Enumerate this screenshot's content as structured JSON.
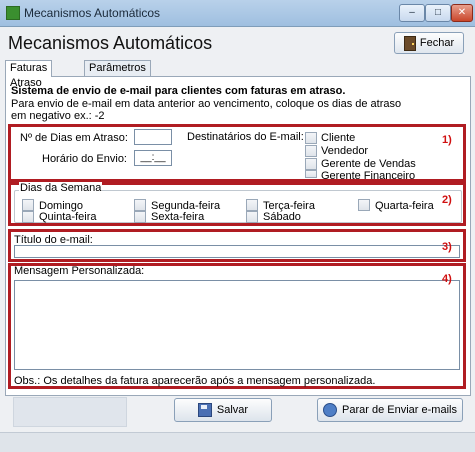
{
  "window": {
    "title": "Mecanismos Automáticos",
    "min": "–",
    "max": "□",
    "close": "✕"
  },
  "header": {
    "title": "Mecanismos Automáticos",
    "fechar_label": "Fechar"
  },
  "tabs": [
    {
      "label": "Faturas Atraso"
    },
    {
      "label": "Parâmetros"
    }
  ],
  "intro": {
    "title": "Sistema de envio de e-mail para clientes com faturas em atraso.",
    "note": "Para envio de e-mail em data anterior ao vencimento, coloque os dias de atraso em negativo ex.: -2"
  },
  "section1": {
    "dias_label": "Nº de Dias em Atraso:",
    "dias_value": "",
    "horario_label": "Horário do Envio:",
    "horario_value": "__:__",
    "dest_label": "Destinatários do E-mail:",
    "destinatarios": [
      "Cliente",
      "Vendedor",
      "Gerente de Vendas",
      "Gerente Financeiro"
    ],
    "marker": "1)"
  },
  "section2": {
    "legend": "Dias da Semana",
    "days": [
      "Domingo",
      "Segunda-feira",
      "Terça-feira",
      "Quarta-feira",
      "Quinta-feira",
      "Sexta-feira",
      "Sábado"
    ],
    "marker": "2)"
  },
  "section3": {
    "label": "Título do e-mail:",
    "value": "",
    "marker": "3)"
  },
  "section4": {
    "label": "Mensagem Personalizada:",
    "value": "",
    "marker": "4)",
    "obs": "Obs.: Os detalhes da fatura aparecerão após a mensagem personalizada."
  },
  "buttons": {
    "salvar": "Salvar",
    "parar": "Parar de Enviar e-mails"
  },
  "colors": {
    "marker_red": "#b01c22"
  }
}
